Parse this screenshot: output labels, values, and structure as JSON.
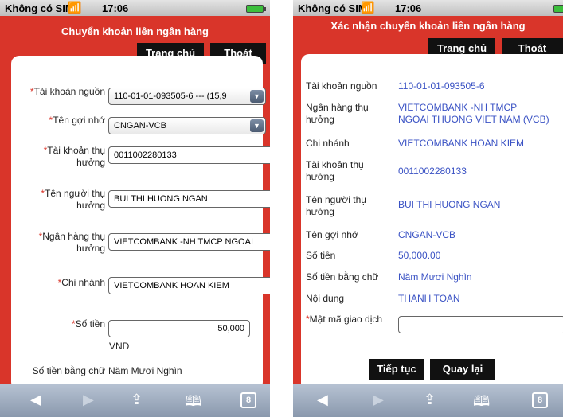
{
  "status": {
    "carrier": "Không có SIM",
    "time": "17:06"
  },
  "left": {
    "title": "Chuyển khoản liên ngân hàng",
    "home_label": "Trang chủ",
    "exit_label": "Thoát",
    "form": {
      "source_account_label": "Tài khoản nguồn",
      "source_account_value": "110-01-01-093505-6 --- (15,9",
      "nickname_label": "Tên gợi nhớ",
      "nickname_value": "CNGAN-VCB",
      "beneficiary_account_label_1": "Tài khoản thụ",
      "beneficiary_account_label_2": "hưởng",
      "beneficiary_account_value": "0011002280133",
      "beneficiary_name_label_1": "Tên người thụ",
      "beneficiary_name_label_2": "hưởng",
      "beneficiary_name_value": "BUI THI HUONG NGAN",
      "bank_label_1": "Ngân hàng thụ",
      "bank_label_2": "hưởng",
      "bank_value": "VIETCOMBANK -NH TMCP NGOAI",
      "branch_label": "Chi nhánh",
      "branch_value": "VIETCOMBANK HOAN KIEM",
      "amount_label": "Số tiền",
      "amount_value": "50,000",
      "currency": "VND",
      "amount_words_label": "Số tiền bằng chữ",
      "amount_words_value": "Năm Mươi Nghìn"
    }
  },
  "right": {
    "title": "Xác nhận chuyển khoản liên ngân hàng",
    "home_label": "Trang chủ",
    "exit_label": "Thoát",
    "rows": [
      {
        "label": "Tài khoản nguồn",
        "value": "110-01-01-093505-6"
      },
      {
        "label": "Ngân hàng thụ",
        "label2": "hưởng",
        "value": "VIETCOMBANK -NH TMCP",
        "value2": "NGOAI THUONG VIET NAM (VCB)"
      },
      {
        "label": "Chi nhánh",
        "value": "VIETCOMBANK HOAN KIEM"
      },
      {
        "label": "Tài khoản thụ",
        "label2": "hưởng",
        "value": "0011002280133"
      },
      {
        "label": "Tên người thụ",
        "label2": "hưởng",
        "value": "BUI THI HUONG NGAN"
      },
      {
        "label": "Tên gợi nhớ",
        "value": "CNGAN-VCB"
      },
      {
        "label": "Số tiền",
        "value": "50,000.00"
      },
      {
        "label": "Số tiền bằng chữ",
        "value": "Năm Mươi Nghìn"
      },
      {
        "label": "Nội dung",
        "value": "THANH TOAN"
      }
    ],
    "otp_label": "Mật mã giao dịch",
    "otp_value": "",
    "continue_label": "Tiếp tục",
    "back_label": "Quay lại"
  },
  "toolbar": {
    "back_icon": "left-arrow-icon",
    "forward_icon": "right-arrow-icon",
    "share_icon": "share-icon",
    "bookmarks_icon": "book-icon",
    "tabs_count": "8"
  }
}
